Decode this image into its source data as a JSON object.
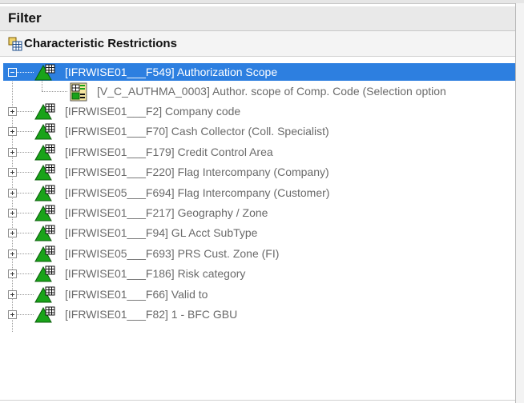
{
  "panel": {
    "title": "Filter",
    "section_title": "Characteristic Restrictions"
  },
  "tree": {
    "selected_node": "[IFRWISE01___F549] Authorization Scope",
    "child_node": "[V_C_AUTHMA_0003] Author. scope of Comp. Code (Selection option",
    "nodes": [
      "[IFRWISE01___F2] Company code",
      "[IFRWISE01___F70] Cash Collector (Coll. Specialist)",
      "[IFRWISE01___F179] Credit Control Area",
      "[IFRWISE01___F220] Flag Intercompany (Company)",
      "[IFRWISE05___F694] Flag Intercompany (Customer)",
      "[IFRWISE01___F217] Geography / Zone",
      "[IFRWISE01___F94] GL Acct SubType",
      "[IFRWISE05___F693] PRS Cust. Zone (FI)",
      "[IFRWISE01___F186] Risk category",
      "[IFRWISE01___F66] Valid to",
      "[IFRWISE01___F82] 1 - BFC GBU"
    ]
  },
  "icons": {
    "section": "characteristics-table-icon",
    "characteristic": "characteristic-triangle-grid-icon",
    "selection_variable": "selection-variable-icon"
  },
  "colors": {
    "selection": "#2d7fe0",
    "triangle_green": "#19a319",
    "text_gray": "#6a6a6a"
  }
}
